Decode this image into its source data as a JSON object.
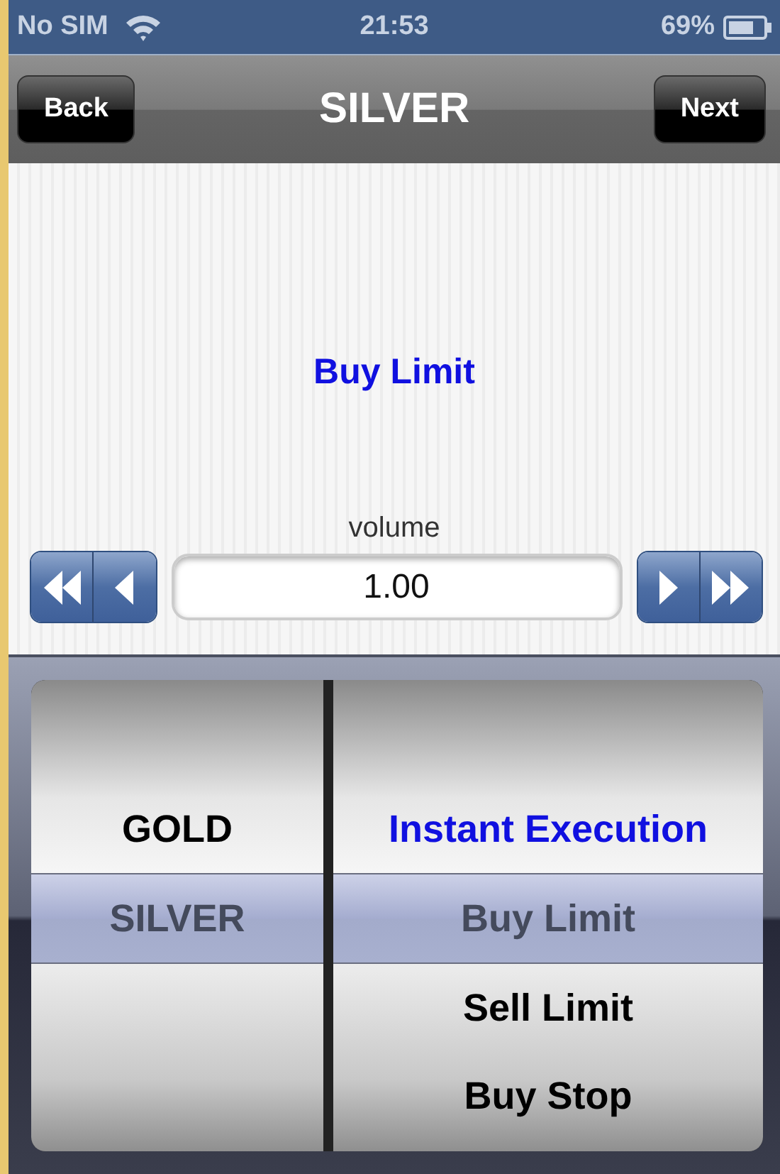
{
  "status_bar": {
    "carrier": "No SIM",
    "time": "21:53",
    "battery": "69%"
  },
  "nav_bar": {
    "back": "Back",
    "title": "SILVER",
    "next": "Next"
  },
  "order_type": "Buy Limit",
  "volume": {
    "label": "volume",
    "value": "1.00"
  },
  "picker": {
    "columns": [
      {
        "items": [
          {
            "label": "GOLD",
            "kind": "option",
            "selected": false
          },
          {
            "label": "SILVER",
            "kind": "option",
            "selected": true
          }
        ]
      },
      {
        "items": [
          {
            "label": "Instant Execution",
            "kind": "group",
            "selected": false
          },
          {
            "label": "Buy Limit",
            "kind": "option",
            "selected": true
          },
          {
            "label": "Sell Limit",
            "kind": "option",
            "selected": false
          },
          {
            "label": "Buy Stop",
            "kind": "option",
            "selected": false
          }
        ]
      }
    ]
  }
}
